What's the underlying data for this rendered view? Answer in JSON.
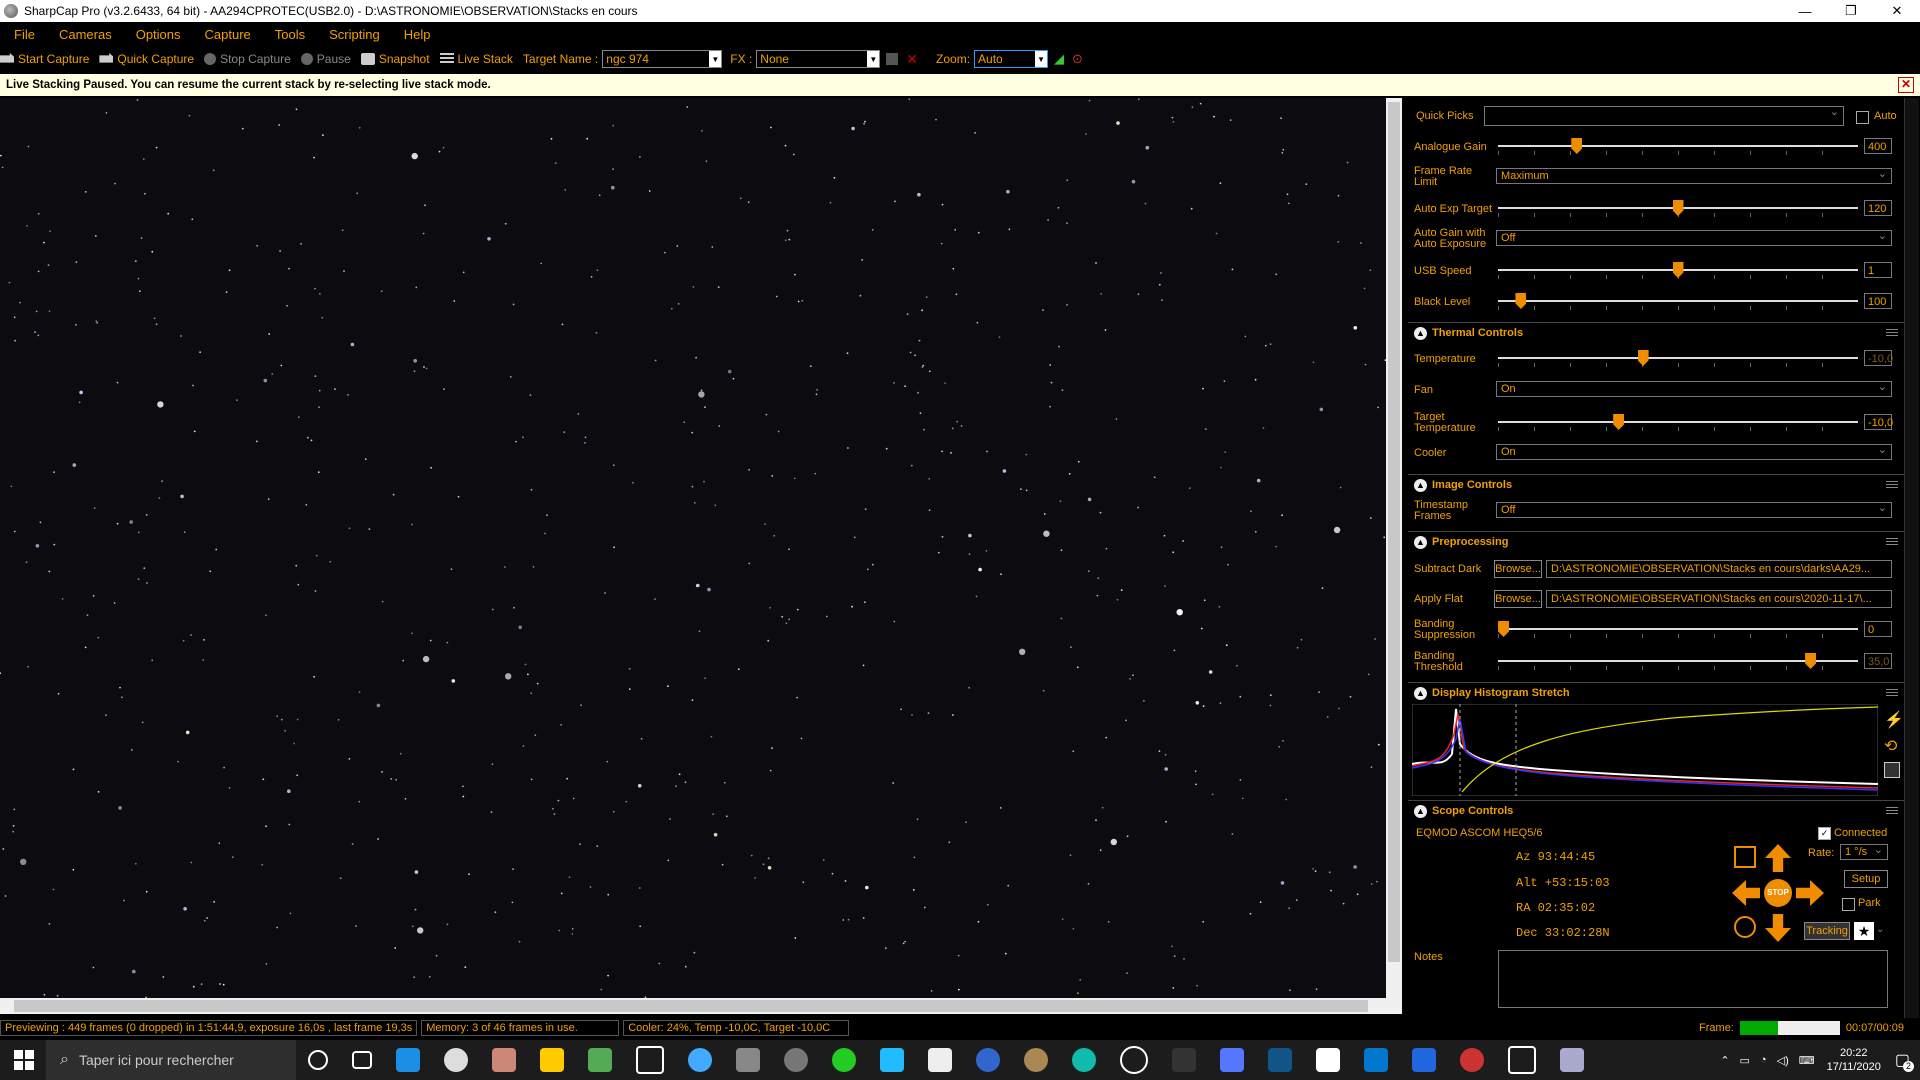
{
  "window": {
    "title": "SharpCap Pro (v3.2.6433, 64 bit) - AA294CPROTEC(USB2.0) - D:\\ASTRONOMIE\\OBSERVATION\\Stacks en cours"
  },
  "menu": [
    "File",
    "Cameras",
    "Options",
    "Capture",
    "Tools",
    "Scripting",
    "Help"
  ],
  "toolbar": {
    "start_capture": "Start Capture",
    "quick_capture": "Quick Capture",
    "stop_capture": "Stop Capture",
    "pause": "Pause",
    "snapshot": "Snapshot",
    "live_stack": "Live Stack",
    "target_label": "Target Name :",
    "target_value": "ngc 974",
    "fx_label": "FX :",
    "fx_value": "None",
    "zoom_label": "Zoom:",
    "zoom_value": "Auto"
  },
  "notice": {
    "text": "Live Stacking Paused. You can resume the current stack by re-selecting live stack mode."
  },
  "camera": {
    "quick_picks_label": "Quick Picks",
    "auto_label": "Auto",
    "analogue_gain": {
      "label": "Analogue Gain",
      "value": "400",
      "level": 0.21
    },
    "frame_rate": {
      "label": "Frame Rate Limit",
      "value": "Maximum"
    },
    "auto_exp_target": {
      "label": "Auto Exp Target",
      "value": "120",
      "level": 0.5
    },
    "auto_gain": {
      "label": "Auto Gain with Auto Exposure",
      "value": "Off"
    },
    "usb_speed": {
      "label": "USB Speed",
      "value": "1",
      "level": 0.5
    },
    "black_level": {
      "label": "Black Level",
      "value": "100",
      "level": 0.05
    }
  },
  "thermal": {
    "title": "Thermal Controls",
    "temperature": {
      "label": "Temperature",
      "value": "-10,0",
      "level": 0.4
    },
    "fan": {
      "label": "Fan",
      "value": "On"
    },
    "target_temp": {
      "label": "Target Temperature",
      "value": "-10,0",
      "level": 0.33
    },
    "cooler": {
      "label": "Cooler",
      "value": "On"
    }
  },
  "image": {
    "title": "Image Controls",
    "timestamp": {
      "label": "Timestamp Frames",
      "value": "Off"
    }
  },
  "preprocessing": {
    "title": "Preprocessing",
    "subtract_dark": {
      "label": "Subtract Dark",
      "browse": "Browse...",
      "path": "D:\\ASTRONOMIE\\OBSERVATION\\Stacks en cours\\darks\\AA29..."
    },
    "apply_flat": {
      "label": "Apply Flat",
      "browse": "Browse...",
      "path": "D:\\ASTRONOMIE\\OBSERVATION\\Stacks en cours\\2020-11-17\\..."
    },
    "banding_suppression": {
      "label": "Banding Suppression",
      "value": "0",
      "level": 0.0
    },
    "banding_threshold": {
      "label": "Banding Threshold",
      "value": "35,0",
      "level": 0.88
    }
  },
  "histogram": {
    "title": "Display Histogram Stretch"
  },
  "scope": {
    "title": "Scope Controls",
    "mount": "EQMOD ASCOM HEQ5/6",
    "connected_label": "Connected",
    "az": "Az  93:44:45",
    "alt": "Alt +53:15:03",
    "ra": "RA  02:35:02",
    "dec": "Dec  33:02:28N",
    "rate_label": "Rate:",
    "rate_value": "1 °/s",
    "setup": "Setup",
    "park": "Park",
    "tracking": "Tracking",
    "stop": "STOP",
    "notes_label": "Notes"
  },
  "status": {
    "preview": "Previewing : 449 frames (0 dropped) in 1:51:44,9, exposure 16,0s , last frame 19,3s",
    "memory": "Memory: 3 of 46 frames in use.",
    "cooler": "Cooler: 24%, Temp -10,0C, Target -10,0C",
    "frame_label": "Frame:",
    "frame_time": "00:07/00:09"
  },
  "taskbar": {
    "search_placeholder": "Taper ici pour rechercher",
    "time": "20:22",
    "date": "17/11/2020",
    "notifications": "2"
  }
}
